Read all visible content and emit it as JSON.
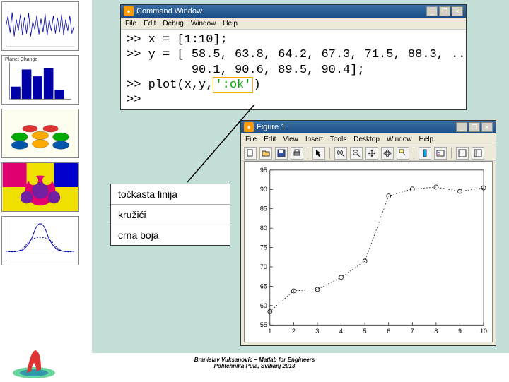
{
  "cmdWindow": {
    "title": "Command Window",
    "menu": [
      "File",
      "Edit",
      "Debug",
      "Window",
      "Help"
    ],
    "code": ">> x = [1:10];\n>> y = [ 58.5, 63.8, 64.2, 67.3, 71.5, 88.3, ...\n         90.1, 90.6, 89.5, 90.4];\n>> plot(x,y,",
    "codeFmt": "':ok'",
    "codeEnd": ")\n>>"
  },
  "legend": {
    "l1": "točkasta linija",
    "l2": "kružići",
    "l3": "crna boja"
  },
  "figWindow": {
    "title": "Figure 1",
    "menu": [
      "File",
      "Edit",
      "View",
      "Insert",
      "Tools",
      "Desktop",
      "Window",
      "Help"
    ]
  },
  "chart_data": {
    "type": "scatter_line_dotted",
    "x": [
      1,
      2,
      3,
      4,
      5,
      6,
      7,
      8,
      9,
      10
    ],
    "y": [
      58.5,
      63.8,
      64.2,
      67.3,
      71.5,
      88.3,
      90.1,
      90.6,
      89.5,
      90.4
    ],
    "xticks": [
      1,
      2,
      3,
      4,
      5,
      6,
      7,
      8,
      9,
      10
    ],
    "yticks": [
      55,
      60,
      65,
      70,
      75,
      80,
      85,
      90,
      95
    ],
    "xlim": [
      1,
      10
    ],
    "ylim": [
      55,
      95
    ],
    "marker": "o",
    "line": ":",
    "color": "#000"
  },
  "thumbs": {
    "t2_label": "Planet Change"
  },
  "footer": {
    "l1": "Branislav Vuksanovic – Matlab for Engineers",
    "l2": "Politehnika Pula, Svibanj 2013"
  },
  "icons": {
    "min": "_",
    "max": "❐",
    "close": "×"
  }
}
